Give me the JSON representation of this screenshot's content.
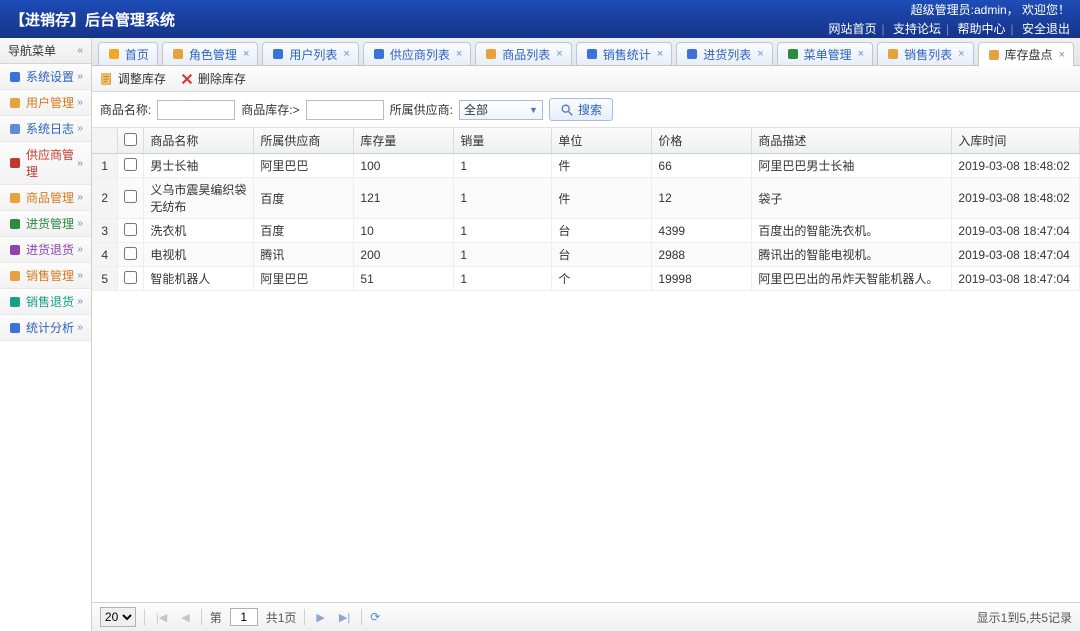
{
  "header": {
    "title": "【进销存】后台管理系统",
    "user_line": "超级管理员:admin， 欢迎您！",
    "links": {
      "home": "网站首页",
      "forum": "支持论坛",
      "help": "帮助中心",
      "logout": "安全退出"
    }
  },
  "nav": {
    "title": "导航菜单",
    "items": [
      {
        "label": "系统设置",
        "color": "c-blue",
        "icon": "gear"
      },
      {
        "label": "用户管理",
        "color": "c-orange",
        "icon": "user"
      },
      {
        "label": "系统日志",
        "color": "c-blue",
        "icon": "log"
      },
      {
        "label": "供应商管理",
        "color": "c-red",
        "icon": "supplier"
      },
      {
        "label": "商品管理",
        "color": "c-orange",
        "icon": "goods"
      },
      {
        "label": "进货管理",
        "color": "c-green",
        "icon": "in"
      },
      {
        "label": "进货退货",
        "color": "c-purple",
        "icon": "inret"
      },
      {
        "label": "销售管理",
        "color": "c-orange",
        "icon": "sale"
      },
      {
        "label": "销售退货",
        "color": "c-teal",
        "icon": "saleret"
      },
      {
        "label": "统计分析",
        "color": "c-blue",
        "icon": "stats"
      }
    ]
  },
  "tabs": [
    {
      "label": "首页",
      "icon": "home",
      "closable": false
    },
    {
      "label": "角色管理",
      "icon": "role",
      "closable": true
    },
    {
      "label": "用户列表",
      "icon": "users",
      "closable": true
    },
    {
      "label": "供应商列表",
      "icon": "sup",
      "closable": true
    },
    {
      "label": "商品列表",
      "icon": "goods",
      "closable": true
    },
    {
      "label": "销售统计",
      "icon": "chart",
      "closable": true
    },
    {
      "label": "进货列表",
      "icon": "inlist",
      "closable": true
    },
    {
      "label": "菜单管理",
      "icon": "menu",
      "closable": true
    },
    {
      "label": "销售列表",
      "icon": "salelist",
      "closable": true
    },
    {
      "label": "库存盘点",
      "icon": "stock",
      "closable": true,
      "active": true
    }
  ],
  "toolbar": {
    "adjust": "调整库存",
    "delete": "删除库存"
  },
  "search": {
    "name_label": "商品名称:",
    "stock_label": "商品库存:>",
    "supplier_label": "所属供应商:",
    "supplier_value": "全部",
    "search_btn": "搜索"
  },
  "columns": [
    "",
    "",
    "商品名称",
    "所属供应商",
    "库存量",
    "销量",
    "单位",
    "价格",
    "商品描述",
    "入库时间"
  ],
  "rows": [
    {
      "n": "1",
      "name": "男士长袖",
      "supplier": "阿里巴巴",
      "stock": "100",
      "sales": "1",
      "unit": "件",
      "price": "66",
      "desc": "阿里巴巴男士长袖",
      "time": "2019-03-08 18:48:02"
    },
    {
      "n": "2",
      "name": "义乌市震昊编织袋无纺布",
      "supplier": "百度",
      "stock": "121",
      "sales": "1",
      "unit": "件",
      "price": "12",
      "desc": "袋子",
      "time": "2019-03-08 18:48:02"
    },
    {
      "n": "3",
      "name": "洗衣机",
      "supplier": "百度",
      "stock": "10",
      "sales": "1",
      "unit": "台",
      "price": "4399",
      "desc": "百度出的智能洗衣机。",
      "time": "2019-03-08 18:47:04"
    },
    {
      "n": "4",
      "name": "电视机",
      "supplier": "腾讯",
      "stock": "200",
      "sales": "1",
      "unit": "台",
      "price": "2988",
      "desc": "腾讯出的智能电视机。",
      "time": "2019-03-08 18:47:04"
    },
    {
      "n": "5",
      "name": "智能机器人",
      "supplier": "阿里巴巴",
      "stock": "51",
      "sales": "1",
      "unit": "个",
      "price": "19998",
      "desc": "阿里巴巴出的吊炸天智能机器人。",
      "time": "2019-03-08 18:47:04"
    }
  ],
  "pager": {
    "page_size": "20",
    "page_prefix": "第",
    "page_value": "1",
    "page_suffix": "共1页",
    "info": "显示1到5,共5记录"
  }
}
